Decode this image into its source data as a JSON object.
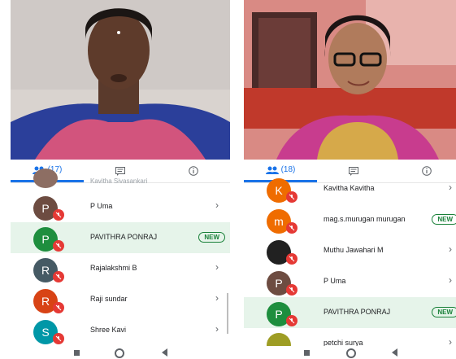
{
  "left": {
    "tabs": {
      "people_count": "(17)"
    },
    "partial_row_name": "Kavitha Sivasankari",
    "participants": [
      {
        "initial": "P",
        "name": "P Uma",
        "color": "#6d4c41",
        "badge": "",
        "highlighted": false
      },
      {
        "initial": "P",
        "name": "PAVITHRA PONRAJ",
        "color": "#1e8e3e",
        "badge": "NEW",
        "highlighted": true
      },
      {
        "initial": "R",
        "name": "Rajalakshmi B",
        "color": "#455a64",
        "badge": "",
        "highlighted": false
      },
      {
        "initial": "R",
        "name": "Raji sundar",
        "color": "#d84315",
        "badge": "",
        "highlighted": false
      },
      {
        "initial": "S",
        "name": "Shree Kavi",
        "color": "#0097a7",
        "badge": "",
        "highlighted": false
      }
    ]
  },
  "right": {
    "tabs": {
      "people_count": "(18)"
    },
    "participants": [
      {
        "initial": "K",
        "name": "Kavitha Kavitha",
        "color": "#ef6c00",
        "badge": "",
        "highlighted": false
      },
      {
        "initial": "m",
        "name": "mag.s.murugan murugan",
        "color": "#ef6c00",
        "badge": "NEW",
        "highlighted": false
      },
      {
        "initial": "",
        "name": "Muthu Jawahari M",
        "color": "#212121",
        "badge": "",
        "highlighted": false
      },
      {
        "initial": "P",
        "name": "P Uma",
        "color": "#6d4c41",
        "badge": "",
        "highlighted": false
      },
      {
        "initial": "P",
        "name": "PAVITHRA PONRAJ",
        "color": "#1e8e3e",
        "badge": "NEW",
        "highlighted": true
      },
      {
        "initial": "",
        "name": "petchi surya",
        "color": "#9e9d24",
        "badge": "",
        "highlighted": false
      }
    ]
  },
  "icons": {
    "people": "people-icon",
    "chat": "chat-icon",
    "info": "info-icon",
    "mic_off": "mic-off-icon",
    "chevron": "chevron-right-icon"
  }
}
